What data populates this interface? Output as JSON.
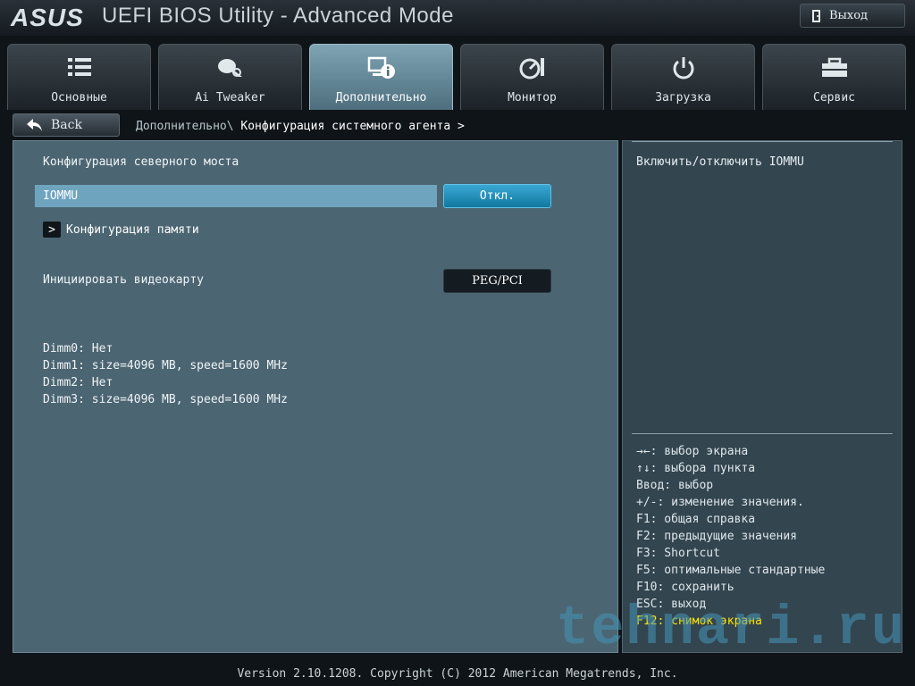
{
  "header": {
    "logo": "ASUS",
    "title": "UEFI BIOS Utility - Advanced Mode",
    "exit_label": "Выход"
  },
  "tabs": [
    {
      "label": "Основные",
      "icon": "list-icon"
    },
    {
      "label": "Ai Tweaker",
      "icon": "tweaker-icon"
    },
    {
      "label": "Дополнительно",
      "icon": "advanced-info-icon"
    },
    {
      "label": "Монитор",
      "icon": "monitor-gauge-icon"
    },
    {
      "label": "Загрузка",
      "icon": "power-icon"
    },
    {
      "label": "Сервис",
      "icon": "tool-icon"
    }
  ],
  "active_tab": "Дополнительно",
  "nav": {
    "back_label": "Back",
    "breadcrumb_parent": "Дополнительно\\",
    "breadcrumb_current": "Конфигурация системного агента >"
  },
  "main": {
    "section_title": "Конфигурация северного моста",
    "iommu": {
      "label": "IOMMU",
      "value": "Откл."
    },
    "memory_config_label": "Конфигурация памяти",
    "gpu_init": {
      "label": "Инициировать видеокарту",
      "value": "PEG/PCI"
    },
    "dimms": [
      "Dimm0: Нет",
      "Dimm1: size=4096 MB, speed=1600 MHz",
      "Dimm2: Нет",
      "Dimm3: size=4096 MB, speed=1600 MHz"
    ]
  },
  "help": {
    "description": "Включить/отключить IOMMU",
    "keys": [
      "→←: выбор экрана",
      "↑↓: выбора пункта",
      "Ввод: выбор",
      "+/-: изменение значения.",
      "F1: общая справка",
      "F2: предыдущие значения",
      "F3: Shortcut",
      "F5: оптимальные стандартные",
      "F10: сохранить",
      "ESC: выход"
    ],
    "highlight_key": "F12: снимок экрана"
  },
  "watermark": "tehnari.ru",
  "footer": "Version 2.10.1208. Copyright (C) 2012 American Megatrends, Inc.",
  "colors": {
    "active_tab": "#6f93a3",
    "selected_row": "#6fa4bf",
    "value_button": "#1b8fbf",
    "highlight_text": "#ffe600"
  }
}
